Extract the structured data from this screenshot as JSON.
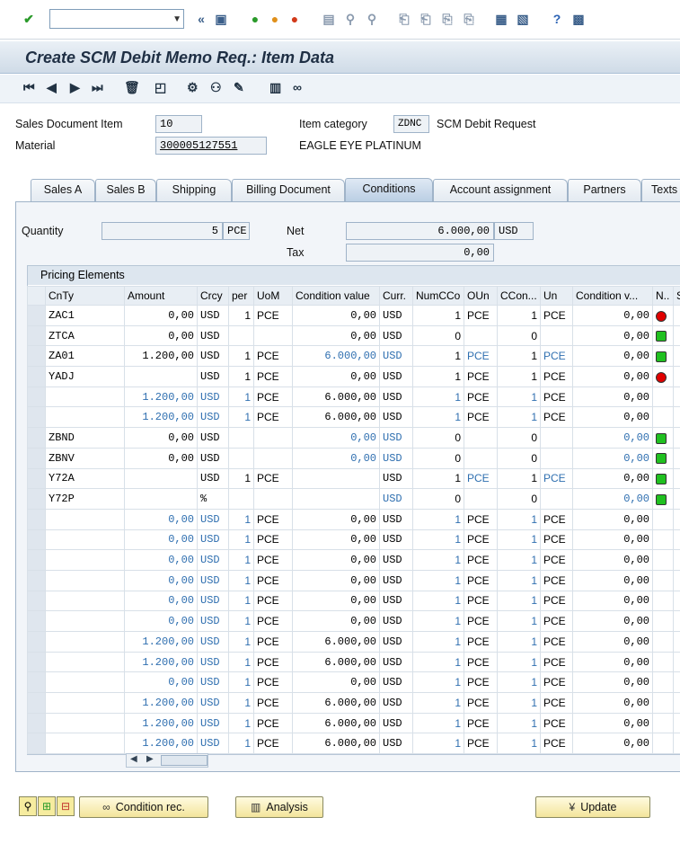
{
  "window": {
    "title": "Create SCM Debit Memo Req.: Item Data"
  },
  "header": {
    "sales_document_item_label": "Sales Document Item",
    "sales_document_item_value": "10",
    "item_category_label": "Item category",
    "item_category_value": "ZDNC",
    "item_category_text": "SCM Debit Request",
    "material_label": "Material",
    "material_value": "300005127551",
    "material_text": "EAGLE EYE PLATINUM"
  },
  "tabs": [
    "Sales A",
    "Sales B",
    "Shipping",
    "Billing Document",
    "Conditions",
    "Account assignment",
    "Partners",
    "Texts"
  ],
  "conditions": {
    "quantity_label": "Quantity",
    "quantity_value": "5",
    "quantity_unit": "PCE",
    "net_label": "Net",
    "net_value": "6.000,00",
    "net_currency": "USD",
    "tax_label": "Tax",
    "tax_value": "0,00"
  },
  "pricing": {
    "title": "Pricing Elements",
    "columns": [
      "CnTy",
      "Amount",
      "Crcy",
      "per",
      "UoM",
      "Condition value",
      "Curr.",
      "NumCCo",
      "OUn",
      "CCon...",
      "Un",
      "Condition v...",
      "N..",
      "S"
    ],
    "rows": [
      {
        "cnty": "ZAC1",
        "amount": "0,00",
        "crcy": "USD",
        "per": "1",
        "uom": "PCE",
        "value": "0,00",
        "curr": "USD",
        "num": "1",
        "oun": "PCE",
        "ccon": "1",
        "un": "PCE",
        "cv": "0,00",
        "status": "red"
      },
      {
        "cnty": "ZTCA",
        "amount": "0,00",
        "crcy": "USD",
        "per": "",
        "uom": "",
        "value": "0,00",
        "curr": "USD",
        "num": "0",
        "oun": "",
        "ccon": "0",
        "un": "",
        "cv": "0,00",
        "status": "green"
      },
      {
        "cnty": "ZA01",
        "amount": "1.200,00",
        "crcy": "USD",
        "per": "1",
        "uom": "PCE",
        "value": "6.000,00",
        "curr": "USD",
        "num": "1",
        "oun": "PCE",
        "ccon": "1",
        "un": "PCE",
        "cv": "0,00",
        "status": "green"
      },
      {
        "cnty": "YADJ",
        "amount": "",
        "crcy": "USD",
        "per": "1",
        "uom": "PCE",
        "value": "0,00",
        "curr": "USD",
        "num": "1",
        "oun": "PCE",
        "ccon": "1",
        "un": "PCE",
        "cv": "0,00",
        "status": "red"
      },
      {
        "cnty": "",
        "amount": "1.200,00",
        "crcy": "USD",
        "per": "1",
        "uom": "PCE",
        "value": "6.000,00",
        "curr": "USD",
        "num": "1",
        "oun": "PCE",
        "ccon": "1",
        "un": "PCE",
        "cv": "0,00",
        "status": ""
      },
      {
        "cnty": "",
        "amount": "1.200,00",
        "crcy": "USD",
        "per": "1",
        "uom": "PCE",
        "value": "6.000,00",
        "curr": "USD",
        "num": "1",
        "oun": "PCE",
        "ccon": "1",
        "un": "PCE",
        "cv": "0,00",
        "status": ""
      },
      {
        "cnty": "ZBND",
        "amount": "0,00",
        "crcy": "USD",
        "per": "",
        "uom": "",
        "value": "0,00",
        "curr": "USD",
        "num": "0",
        "oun": "",
        "ccon": "0",
        "un": "",
        "cv": "0,00",
        "status": "green"
      },
      {
        "cnty": "ZBNV",
        "amount": "0,00",
        "crcy": "USD",
        "per": "",
        "uom": "",
        "value": "0,00",
        "curr": "USD",
        "num": "0",
        "oun": "",
        "ccon": "0",
        "un": "",
        "cv": "0,00",
        "status": "green"
      },
      {
        "cnty": "Y72A",
        "amount": "",
        "crcy": "USD",
        "per": "1",
        "uom": "PCE",
        "value": "",
        "curr": "USD",
        "num": "1",
        "oun": "PCE",
        "ccon": "1",
        "un": "PCE",
        "cv": "0,00",
        "status": "green"
      },
      {
        "cnty": "Y72P",
        "amount": "",
        "crcy": "%",
        "per": "",
        "uom": "",
        "value": "",
        "curr": "USD",
        "num": "0",
        "oun": "",
        "ccon": "0",
        "un": "",
        "cv": "0,00",
        "status": "green"
      },
      {
        "cnty": "",
        "amount": "0,00",
        "crcy": "USD",
        "per": "1",
        "uom": "PCE",
        "value": "0,00",
        "curr": "USD",
        "num": "1",
        "oun": "PCE",
        "ccon": "1",
        "un": "PCE",
        "cv": "0,00",
        "status": ""
      },
      {
        "cnty": "",
        "amount": "0,00",
        "crcy": "USD",
        "per": "1",
        "uom": "PCE",
        "value": "0,00",
        "curr": "USD",
        "num": "1",
        "oun": "PCE",
        "ccon": "1",
        "un": "PCE",
        "cv": "0,00",
        "status": ""
      },
      {
        "cnty": "",
        "amount": "0,00",
        "crcy": "USD",
        "per": "1",
        "uom": "PCE",
        "value": "0,00",
        "curr": "USD",
        "num": "1",
        "oun": "PCE",
        "ccon": "1",
        "un": "PCE",
        "cv": "0,00",
        "status": ""
      },
      {
        "cnty": "",
        "amount": "0,00",
        "crcy": "USD",
        "per": "1",
        "uom": "PCE",
        "value": "0,00",
        "curr": "USD",
        "num": "1",
        "oun": "PCE",
        "ccon": "1",
        "un": "PCE",
        "cv": "0,00",
        "status": ""
      },
      {
        "cnty": "",
        "amount": "0,00",
        "crcy": "USD",
        "per": "1",
        "uom": "PCE",
        "value": "0,00",
        "curr": "USD",
        "num": "1",
        "oun": "PCE",
        "ccon": "1",
        "un": "PCE",
        "cv": "0,00",
        "status": ""
      },
      {
        "cnty": "",
        "amount": "0,00",
        "crcy": "USD",
        "per": "1",
        "uom": "PCE",
        "value": "0,00",
        "curr": "USD",
        "num": "1",
        "oun": "PCE",
        "ccon": "1",
        "un": "PCE",
        "cv": "0,00",
        "status": ""
      },
      {
        "cnty": "",
        "amount": "1.200,00",
        "crcy": "USD",
        "per": "1",
        "uom": "PCE",
        "value": "6.000,00",
        "curr": "USD",
        "num": "1",
        "oun": "PCE",
        "ccon": "1",
        "un": "PCE",
        "cv": "0,00",
        "status": ""
      },
      {
        "cnty": "",
        "amount": "1.200,00",
        "crcy": "USD",
        "per": "1",
        "uom": "PCE",
        "value": "6.000,00",
        "curr": "USD",
        "num": "1",
        "oun": "PCE",
        "ccon": "1",
        "un": "PCE",
        "cv": "0,00",
        "status": ""
      },
      {
        "cnty": "",
        "amount": "0,00",
        "crcy": "USD",
        "per": "1",
        "uom": "PCE",
        "value": "0,00",
        "curr": "USD",
        "num": "1",
        "oun": "PCE",
        "ccon": "1",
        "un": "PCE",
        "cv": "0,00",
        "status": ""
      },
      {
        "cnty": "",
        "amount": "1.200,00",
        "crcy": "USD",
        "per": "1",
        "uom": "PCE",
        "value": "6.000,00",
        "curr": "USD",
        "num": "1",
        "oun": "PCE",
        "ccon": "1",
        "un": "PCE",
        "cv": "0,00",
        "status": ""
      },
      {
        "cnty": "",
        "amount": "1.200,00",
        "crcy": "USD",
        "per": "1",
        "uom": "PCE",
        "value": "6.000,00",
        "curr": "USD",
        "num": "1",
        "oun": "PCE",
        "ccon": "1",
        "un": "PCE",
        "cv": "0,00",
        "status": ""
      },
      {
        "cnty": "",
        "amount": "1.200,00",
        "crcy": "USD",
        "per": "1",
        "uom": "PCE",
        "value": "6.000,00",
        "curr": "USD",
        "num": "1",
        "oun": "PCE",
        "ccon": "1",
        "un": "PCE",
        "cv": "0,00",
        "status": ""
      }
    ]
  },
  "buttons": {
    "condition_rec": "Condition rec.",
    "analysis": "Analysis",
    "update": "Update"
  }
}
